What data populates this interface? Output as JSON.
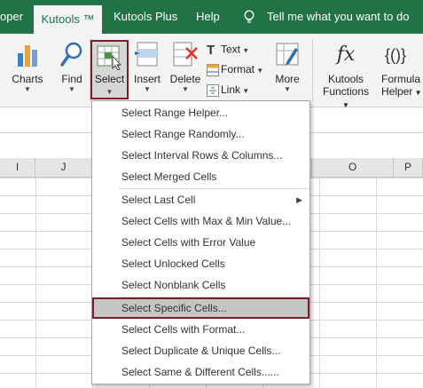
{
  "tabs": [
    {
      "label": "oper"
    },
    {
      "label": "Kutools ™"
    },
    {
      "label": "Kutools Plus"
    },
    {
      "label": "Help"
    }
  ],
  "tell_me": "Tell me what you want to do",
  "ribbon": {
    "charts": "Charts",
    "find": "Find",
    "select": "Select",
    "insert": "Insert",
    "delete": "Delete",
    "text": "Text",
    "format": "Format",
    "link": "Link",
    "more": "More",
    "kutools_functions_1": "Kutools",
    "kutools_functions_2": "Functions",
    "formula_helper_1": "Formula",
    "formula_helper_2": "Helper",
    "fx_glyph": "fx",
    "braces_glyph": "{()}"
  },
  "columns": [
    "I",
    "J",
    "O",
    "P"
  ],
  "menu": {
    "items": [
      "Select Range Helper...",
      "Select Range Randomly...",
      "Select Interval Rows & Columns...",
      "Select Merged Cells",
      "Select Last Cell",
      "Select Cells with Max & Min Value...",
      "Select Cells with Error Value",
      "Select Unlocked Cells",
      "Select Nonblank Cells",
      "Select Specific Cells...",
      "Select Cells with Format...",
      "Select Duplicate & Unique Cells...",
      "Select Same & Different Cells......"
    ]
  },
  "colors": {
    "tabbar": "#217346",
    "highlight_border": "#7b1e2a",
    "highlight_bg": "#c5c5c5"
  }
}
